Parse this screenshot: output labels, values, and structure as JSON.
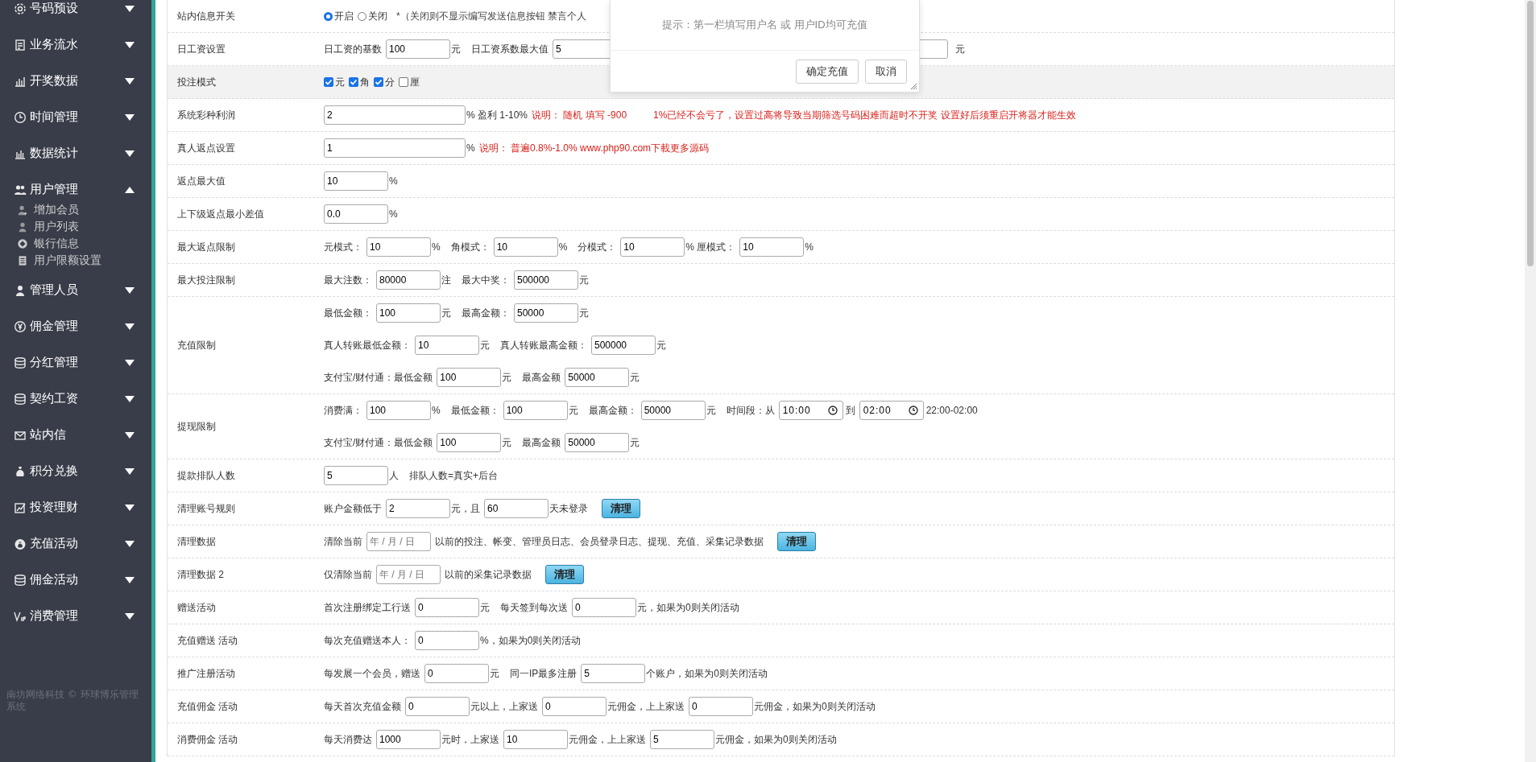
{
  "sidebar": {
    "items": [
      {
        "label": "号码预设",
        "expanded": false
      },
      {
        "label": "业务流水",
        "expanded": false
      },
      {
        "label": "开奖数据",
        "expanded": false
      },
      {
        "label": "时间管理",
        "expanded": false
      },
      {
        "label": "数据统计",
        "expanded": false
      },
      {
        "label": "用户管理",
        "expanded": true,
        "children": [
          {
            "label": "增加会员"
          },
          {
            "label": "用户列表"
          },
          {
            "label": "银行信息"
          },
          {
            "label": "用户限额设置"
          }
        ]
      },
      {
        "label": "管理人员",
        "expanded": false
      },
      {
        "label": "佣金管理",
        "expanded": false
      },
      {
        "label": "分红管理",
        "expanded": false
      },
      {
        "label": "契约工资",
        "expanded": false
      },
      {
        "label": "站内信",
        "expanded": false
      },
      {
        "label": "积分兑换",
        "expanded": false
      },
      {
        "label": "投资理财",
        "expanded": false
      },
      {
        "label": "充值活动",
        "expanded": false
      },
      {
        "label": "佣金活动",
        "expanded": false
      },
      {
        "label": "消费管理",
        "expanded": false
      }
    ],
    "footer": "南坊网络科技 © 环球博乐管理系统"
  },
  "settings": {
    "rows": [
      {
        "label": "站内信息开关",
        "hover": false,
        "lines": [
          [
            {
              "kind": "radio",
              "label": "开启",
              "selected": true
            },
            {
              "kind": "radio",
              "label": "关闭",
              "selected": false
            },
            {
              "kind": "hint",
              "text": "*（关闭则不显示编写发送信息按钮 禁言个人"
            }
          ]
        ]
      },
      {
        "label": "日工资设置",
        "hover": false,
        "lines": [
          [
            {
              "kind": "text",
              "text": "日工资的基数"
            },
            {
              "kind": "field",
              "value": "100"
            },
            {
              "kind": "text",
              "text": "元"
            },
            {
              "kind": "text",
              "text": "日工资系数最大值"
            },
            {
              "kind": "field",
              "value": "5"
            },
            {
              "kind": "blank_field"
            },
            {
              "kind": "text",
              "text": "元"
            }
          ]
        ]
      },
      {
        "label": "投注模式",
        "hover": true,
        "lines": [
          [
            {
              "kind": "checkbox",
              "label": "元",
              "checked": true
            },
            {
              "kind": "checkbox",
              "label": "角",
              "checked": true
            },
            {
              "kind": "checkbox",
              "label": "分",
              "checked": true
            },
            {
              "kind": "checkbox",
              "label": "厘",
              "checked": false
            }
          ]
        ]
      },
      {
        "label": "系统彩种利润",
        "hover": false,
        "lines": [
          [
            {
              "kind": "long_field",
              "value": "2"
            },
            {
              "kind": "text",
              "text": "% 盈利 1-10%"
            },
            {
              "kind": "note",
              "text": "说明： 随机 填写 -900"
            },
            {
              "kind": "note",
              "text": "1%已经不会亏了，设置过高将导致当期筛选号码困难而超时不开奖 设置好后须重启开将器才能生效"
            }
          ]
        ]
      },
      {
        "label": "真人返点设置",
        "hover": false,
        "lines": [
          [
            {
              "kind": "long_field",
              "value": "1"
            },
            {
              "kind": "text",
              "text": "%"
            },
            {
              "kind": "note",
              "text": "说明： 普遍0.8%-1.0% www.php90.com下載更多源码"
            }
          ]
        ]
      },
      {
        "label": "返点最大值",
        "hover": false,
        "lines": [
          [
            {
              "kind": "field",
              "value": "10"
            },
            {
              "kind": "text",
              "text": "%"
            }
          ]
        ]
      },
      {
        "label": "上下级返点最小差值",
        "hover": false,
        "lines": [
          [
            {
              "kind": "field",
              "value": "0.0"
            },
            {
              "kind": "text",
              "text": "%"
            }
          ]
        ]
      },
      {
        "label": "最大返点限制",
        "hover": false,
        "lines": [
          [
            {
              "kind": "text",
              "text": "元模式："
            },
            {
              "kind": "field",
              "value": "10"
            },
            {
              "kind": "text",
              "text": "%"
            },
            {
              "kind": "text",
              "text": "角模式："
            },
            {
              "kind": "field",
              "value": "10"
            },
            {
              "kind": "text",
              "text": "%"
            },
            {
              "kind": "text",
              "text": "分模式："
            },
            {
              "kind": "field",
              "value": "10"
            },
            {
              "kind": "text",
              "text": "% 厘模式："
            },
            {
              "kind": "field",
              "value": "10"
            },
            {
              "kind": "text",
              "text": "%"
            }
          ]
        ]
      },
      {
        "label": "最大投注限制",
        "hover": false,
        "lines": [
          [
            {
              "kind": "text",
              "text": "最大注数："
            },
            {
              "kind": "field",
              "value": "80000"
            },
            {
              "kind": "text",
              "text": "注"
            },
            {
              "kind": "text",
              "text": "最大中奖："
            },
            {
              "kind": "field",
              "value": "500000"
            },
            {
              "kind": "text",
              "text": "元"
            }
          ]
        ]
      },
      {
        "label": "充值限制",
        "hover": false,
        "lines": [
          [
            {
              "kind": "text",
              "text": "最低金额："
            },
            {
              "kind": "field",
              "value": "100"
            },
            {
              "kind": "text",
              "text": "元"
            },
            {
              "kind": "text",
              "text": "最高金额："
            },
            {
              "kind": "field",
              "value": "50000"
            },
            {
              "kind": "text",
              "text": "元"
            }
          ],
          [
            {
              "kind": "text",
              "text": "真人转账最低金额："
            },
            {
              "kind": "field",
              "value": "10"
            },
            {
              "kind": "text",
              "text": "元"
            },
            {
              "kind": "text",
              "text": "真人转账最高金额："
            },
            {
              "kind": "field",
              "value": "500000"
            },
            {
              "kind": "text",
              "text": "元"
            }
          ],
          [
            {
              "kind": "text",
              "text": "支付宝/财付通：最低金额"
            },
            {
              "kind": "field",
              "value": "100"
            },
            {
              "kind": "text",
              "text": "元"
            },
            {
              "kind": "text",
              "text": "最高金额"
            },
            {
              "kind": "field",
              "value": "50000"
            },
            {
              "kind": "text",
              "text": "元"
            }
          ]
        ]
      },
      {
        "label": "提现限制",
        "hover": false,
        "lines": [
          [
            {
              "kind": "text",
              "text": "消费满："
            },
            {
              "kind": "field",
              "value": "100"
            },
            {
              "kind": "text",
              "text": "%"
            },
            {
              "kind": "text",
              "text": "最低金额："
            },
            {
              "kind": "field",
              "value": "100"
            },
            {
              "kind": "text",
              "text": "元"
            },
            {
              "kind": "text",
              "text": "最高金额："
            },
            {
              "kind": "field",
              "value": "50000"
            },
            {
              "kind": "text",
              "text": "元"
            },
            {
              "kind": "text",
              "text": "时间段：从"
            },
            {
              "kind": "time",
              "value": "10:00"
            },
            {
              "kind": "text",
              "text": "到"
            },
            {
              "kind": "time",
              "value": "02:00"
            },
            {
              "kind": "text",
              "text": "22:00-02:00"
            }
          ],
          [
            {
              "kind": "text",
              "text": "支付宝/财付通：最低金额"
            },
            {
              "kind": "field",
              "value": "100"
            },
            {
              "kind": "text",
              "text": "元"
            },
            {
              "kind": "text",
              "text": "最高金额"
            },
            {
              "kind": "field",
              "value": "50000"
            },
            {
              "kind": "text",
              "text": "元"
            }
          ]
        ]
      },
      {
        "label": "提款排队人数",
        "hover": false,
        "lines": [
          [
            {
              "kind": "field",
              "value": "5"
            },
            {
              "kind": "text",
              "text": "人"
            },
            {
              "kind": "text",
              "text": "排队人数=真实+后台"
            }
          ]
        ]
      },
      {
        "label": "清理账号规则",
        "hover": false,
        "lines": [
          [
            {
              "kind": "text",
              "text": "账户金额低于"
            },
            {
              "kind": "field",
              "value": "2"
            },
            {
              "kind": "text",
              "text": "元，且"
            },
            {
              "kind": "field",
              "value": "60"
            },
            {
              "kind": "text",
              "text": "天未登录"
            },
            {
              "kind": "button",
              "label": "清理"
            }
          ]
        ]
      },
      {
        "label": "清理数据",
        "hover": false,
        "lines": [
          [
            {
              "kind": "text",
              "text": "清除当前"
            },
            {
              "kind": "date",
              "placeholder": "年 / 月 / 日"
            },
            {
              "kind": "text",
              "text": "以前的投注、帐变、管理员日志、会员登录日志、提现、充值、采集记录数据"
            },
            {
              "kind": "button",
              "label": "清理"
            }
          ]
        ]
      },
      {
        "label": "清理数据 2",
        "hover": false,
        "lines": [
          [
            {
              "kind": "text",
              "text": "仅清除当前"
            },
            {
              "kind": "date",
              "placeholder": "年 / 月 / 日"
            },
            {
              "kind": "text",
              "text": "以前的采集记录数据"
            },
            {
              "kind": "button",
              "label": "清理"
            }
          ]
        ]
      },
      {
        "label": "赠送活动",
        "hover": false,
        "lines": [
          [
            {
              "kind": "text",
              "text": "首次注册绑定工行送"
            },
            {
              "kind": "field",
              "value": "0"
            },
            {
              "kind": "text",
              "text": "元"
            },
            {
              "kind": "text",
              "text": "每天签到每次送"
            },
            {
              "kind": "field",
              "value": "0"
            },
            {
              "kind": "text",
              "text": "元，如果为0则关闭活动"
            }
          ]
        ]
      },
      {
        "label": "充值赠送 活动",
        "hover": false,
        "lines": [
          [
            {
              "kind": "text",
              "text": "每次充值赠送本人："
            },
            {
              "kind": "field",
              "value": "0"
            },
            {
              "kind": "text",
              "text": "%，如果为0则关闭活动"
            }
          ]
        ]
      },
      {
        "label": "推广注册活动",
        "hover": false,
        "lines": [
          [
            {
              "kind": "text",
              "text": "每发展一个会员，赠送"
            },
            {
              "kind": "field",
              "value": "0"
            },
            {
              "kind": "text",
              "text": "元"
            },
            {
              "kind": "text",
              "text": "同一IP最多注册"
            },
            {
              "kind": "field",
              "value": "5"
            },
            {
              "kind": "text",
              "text": "个账户，如果为0则关闭活动"
            }
          ]
        ]
      },
      {
        "label": "充值佣金 活动",
        "hover": false,
        "lines": [
          [
            {
              "kind": "text",
              "text": "每天首次充值金额"
            },
            {
              "kind": "field",
              "value": "0"
            },
            {
              "kind": "text",
              "text": "元以上，上家送"
            },
            {
              "kind": "field",
              "value": "0"
            },
            {
              "kind": "text",
              "text": "元佣金，上上家送"
            },
            {
              "kind": "field",
              "value": "0"
            },
            {
              "kind": "text",
              "text": "元佣金，如果为0则关闭活动"
            }
          ]
        ]
      },
      {
        "label": "消费佣金 活动",
        "hover": false,
        "lines": [
          [
            {
              "kind": "text",
              "text": "每天消费达"
            },
            {
              "kind": "field",
              "value": "1000"
            },
            {
              "kind": "text",
              "text": "元时，上家送"
            },
            {
              "kind": "field",
              "value": "10"
            },
            {
              "kind": "text",
              "text": "元佣金，上上家送"
            },
            {
              "kind": "field",
              "value": "5"
            },
            {
              "kind": "text",
              "text": "元佣金，如果为0则关闭活动"
            }
          ]
        ]
      }
    ]
  },
  "dialog": {
    "tip": "提示：第一栏填写用户名 或 用户ID均可充值",
    "buttons": [
      "确定充值",
      "取消"
    ]
  }
}
